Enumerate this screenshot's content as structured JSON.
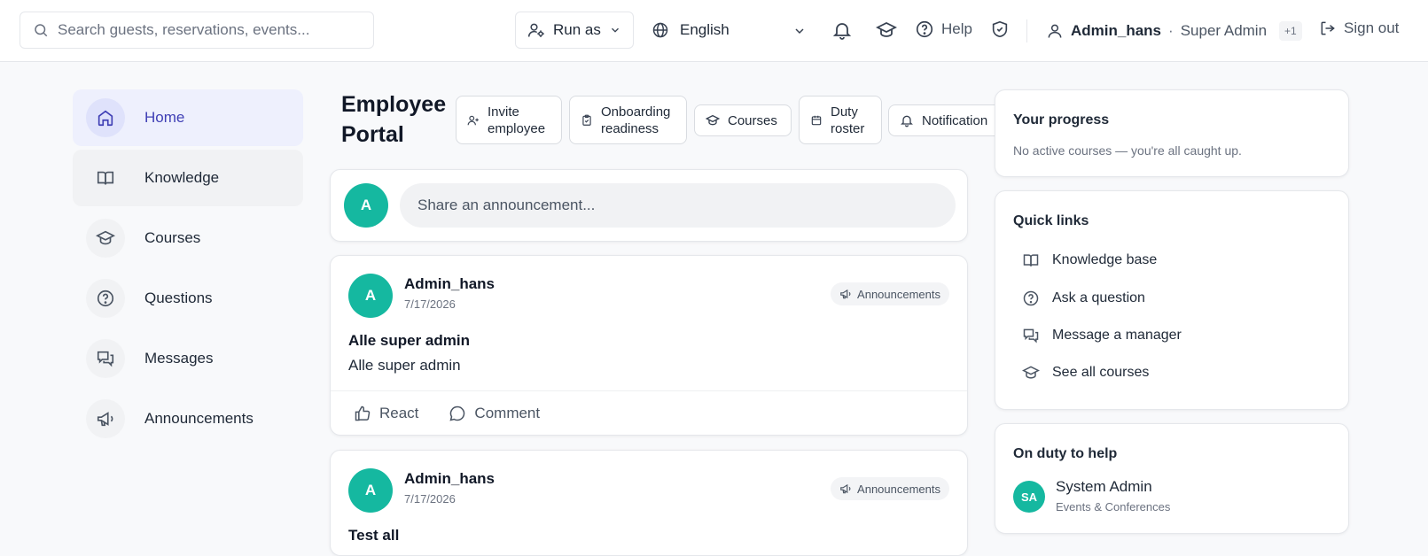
{
  "header": {
    "search_placeholder": "Search guests, reservations, events...",
    "run_as_label": "Run as",
    "language": "English",
    "help_label": "Help",
    "user_name": "Admin_hans",
    "separator": "·",
    "user_role": "Super Admin",
    "role_badge": "+1",
    "sign_out_label": "Sign out"
  },
  "sidebar": {
    "items": [
      {
        "label": "Home",
        "icon": "home-icon"
      },
      {
        "label": "Knowledge",
        "icon": "book-icon"
      },
      {
        "label": "Courses",
        "icon": "graduation-cap-icon"
      },
      {
        "label": "Questions",
        "icon": "question-circle-icon"
      },
      {
        "label": "Messages",
        "icon": "messages-icon"
      },
      {
        "label": "Announcements",
        "icon": "megaphone-icon"
      }
    ]
  },
  "main": {
    "title_line1": "Employee",
    "title_line2": "Portal",
    "actions": [
      {
        "line1": "Invite",
        "line2": "employee",
        "icon": "user-plus-icon"
      },
      {
        "line1": "Onboarding",
        "line2": "readiness",
        "icon": "clipboard-icon"
      },
      {
        "line1": "Courses",
        "line2": "",
        "icon": "graduation-cap-icon"
      },
      {
        "line1": "Duty",
        "line2": "roster",
        "icon": "calendar-icon"
      },
      {
        "line1": "Notification",
        "line2": "",
        "icon": "bell-icon"
      }
    ],
    "composer": {
      "avatar_initial": "A",
      "placeholder": "Share an announcement..."
    },
    "posts": [
      {
        "avatar_initial": "A",
        "author": "Admin_hans",
        "date": "7/17/2026",
        "tag": "Announcements",
        "title": "Alle super admin",
        "body": "Alle super admin",
        "react_label": "React",
        "comment_label": "Comment"
      },
      {
        "avatar_initial": "A",
        "author": "Admin_hans",
        "date": "7/17/2026",
        "tag": "Announcements",
        "title": "Test all"
      }
    ]
  },
  "right": {
    "progress": {
      "title": "Your progress",
      "subtitle": "No active courses — you're all caught up."
    },
    "quick_links": {
      "title": "Quick links",
      "items": [
        {
          "label": "Knowledge base",
          "icon": "book-icon"
        },
        {
          "label": "Ask a question",
          "icon": "question-circle-icon"
        },
        {
          "label": "Message a manager",
          "icon": "messages-icon"
        },
        {
          "label": "See all courses",
          "icon": "graduation-cap-icon"
        }
      ]
    },
    "on_duty": {
      "title": "On duty to help",
      "initials": "SA",
      "name": "System Admin",
      "department": "Events & Conferences"
    }
  },
  "colors": {
    "accent": "#3f3fb5",
    "accent_bg": "#eef0fd",
    "avatar": "#15b8a0"
  }
}
